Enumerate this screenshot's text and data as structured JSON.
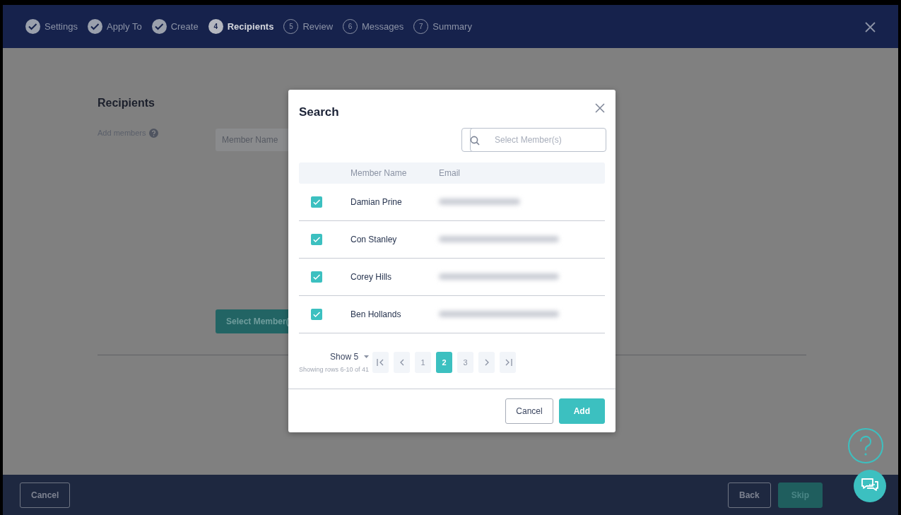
{
  "steps": [
    {
      "label": "Settings",
      "completed": true,
      "selected": false
    },
    {
      "label": "Apply To",
      "completed": true,
      "selected": false
    },
    {
      "label": "Create",
      "completed": true,
      "selected": false
    },
    {
      "number": "4",
      "label": "Recipients",
      "completed": false,
      "selected": true
    },
    {
      "number": "5",
      "label": "Review",
      "completed": false,
      "selected": false
    },
    {
      "number": "6",
      "label": "Messages",
      "completed": false,
      "selected": false
    },
    {
      "number": "7",
      "label": "Summary",
      "completed": false,
      "selected": false
    }
  ],
  "page": {
    "heading": "Recipients",
    "field_label": "Add members",
    "table_header": "Member Name",
    "select_button": "Select Member("
  },
  "modal": {
    "title": "Search",
    "search": {
      "placeholder": "Select Member(s)"
    },
    "columns": [
      "Member Name",
      "Email"
    ],
    "rows": [
      {
        "name": "Damian Prine",
        "checked": true
      },
      {
        "name": "Con Stanley",
        "checked": true
      },
      {
        "name": "Corey Hills",
        "checked": true
      },
      {
        "name": "Ben Hollands",
        "checked": true
      }
    ],
    "page_size": "Show 5",
    "rows_info": "Showing rows 6-10 of 41",
    "pages": [
      {
        "label": "1",
        "selected": false
      },
      {
        "label": "2",
        "selected": true
      },
      {
        "label": "3",
        "selected": false
      }
    ],
    "buttons": [
      "Cancel",
      "Add"
    ]
  },
  "footer": {
    "cancel": "Cancel",
    "back": "Back",
    "skip": "Skip"
  }
}
